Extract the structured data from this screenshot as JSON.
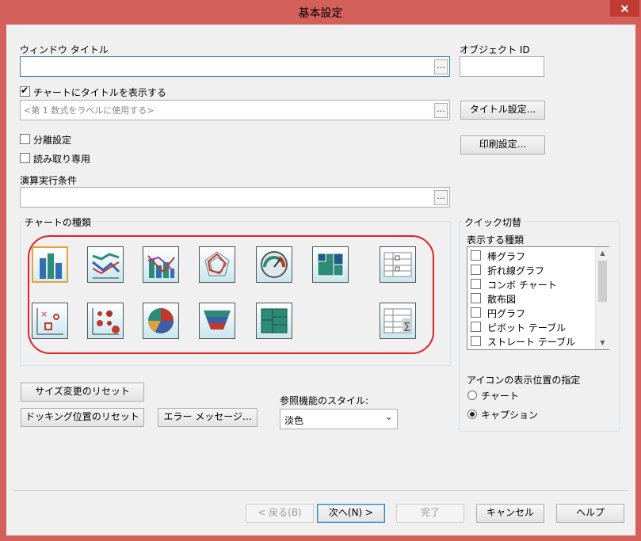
{
  "window": {
    "title": "基本設定",
    "close_label": "✕"
  },
  "form": {
    "window_title_label": "ウィンドウ タイトル",
    "window_title_value": "",
    "browse_label": "...",
    "object_id_label": "オブジェクト ID",
    "object_id_value": "",
    "show_title_label": "チャートにタイトルを表示する",
    "show_title_checked": true,
    "title_expr_placeholder": "<第 1 数式をラベルに使用する>",
    "title_settings_button": "タイトル設定...",
    "print_settings_button": "印刷設定...",
    "detach_label": "分離設定",
    "readonly_label": "読み取り専用",
    "calc_condition_label": "演算実行条件",
    "calc_condition_value": ""
  },
  "chart_types": {
    "group_label": "チャートの種類",
    "selected": "bar-chart",
    "row1": [
      "bar-chart",
      "line-chart",
      "combo-chart",
      "radar-chart",
      "gauge-chart",
      "block-chart",
      "pivot-table"
    ],
    "row2": [
      "scatter-chart",
      "grid-chart",
      "pie-chart",
      "funnel-chart",
      "mekko-chart",
      "straight-table"
    ]
  },
  "quick_change": {
    "group_label": "クイック切替",
    "list_label": "表示する種類",
    "items": [
      "棒グラフ",
      "折れ線グラフ",
      "コンボ チャート",
      "散布図",
      "円グラフ",
      "ピボット テーブル",
      "ストレート テーブル"
    ],
    "scroll_up": "▲",
    "scroll_down": "▼",
    "icon_position_label": "アイコンの表示位置の指定",
    "option_chart": "チャート",
    "option_caption": "キャプション",
    "selected_option": "キャプション"
  },
  "bottom": {
    "reset_size_button": "サイズ変更のリセット",
    "reset_docking_button": "ドッキング位置のリセット",
    "error_message_button": "エラー メッセージ...",
    "lookup_style_label": "参照機能のスタイル:",
    "lookup_style_value": "淡色",
    "dropdown_arrow": "⌄"
  },
  "footer": {
    "back_button": "< 戻る(B)",
    "next_button": "次へ(N) >",
    "finish_button": "完了",
    "cancel_button": "キャンセル",
    "help_button": "ヘルプ"
  },
  "colors": {
    "frame": "#d4605b",
    "close": "#c23b33",
    "client": "#f0f0f0",
    "highlight_oval": "#e3202a",
    "focus_border": "#3c7fb1"
  }
}
